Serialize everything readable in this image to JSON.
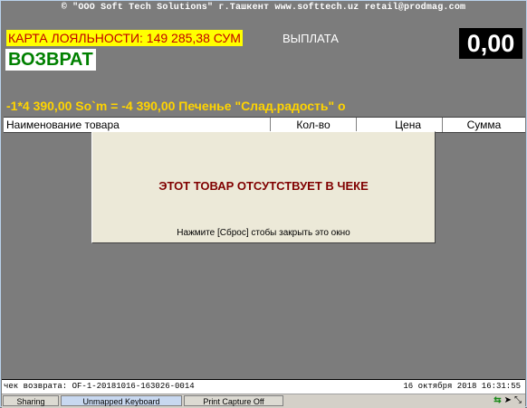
{
  "header": {
    "topline": "© \"ООО Soft Tech Solutions\" г.Ташкент www.softtech.uz retail@prodmag.com"
  },
  "loyalty": {
    "text": "КАРТА ЛОЯЛЬНОСТИ: 149 285,38 СУМ"
  },
  "payment": {
    "label": "ВЫПЛАТА",
    "amount": "0,00"
  },
  "mode": {
    "label": "ВОЗВРАТ"
  },
  "last_item": {
    "text": "-1*4 390,00 So`m = -4 390,00 Печенье  \"Слад.радость\" о"
  },
  "table": {
    "columns": [
      "Наименование товара",
      "Кол-во",
      "Цена",
      "Сумма"
    ],
    "rows": []
  },
  "dialog": {
    "message": "ЭТОТ ТОВАР ОТСУТСТВУЕТ В ЧЕКЕ",
    "hint": "Нажмите [Сброс] стобы закрыть это окно"
  },
  "status": {
    "receipt": "чек возврата: OF-1-20181016-163026-0014",
    "datetime": "16 октября 2018 16:31:55"
  },
  "taskbar": {
    "buttons": [
      "Sharing",
      "Unmapped Keyboard",
      "Print Capture Off"
    ],
    "icons": [
      "arrows-icon",
      "send-icon",
      "resize-icon"
    ]
  },
  "colors": {
    "background": "#7c7c7c",
    "loyalty_bg": "#ffff00",
    "loyalty_text": "#c00000",
    "mode_text": "#008000",
    "last_item_text": "#ffd400",
    "dialog_message": "#800000"
  }
}
